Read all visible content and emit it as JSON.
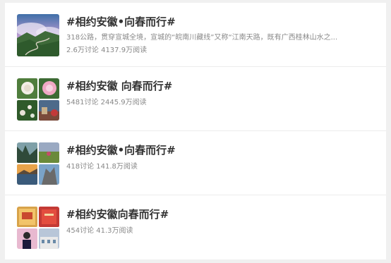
{
  "topics": [
    {
      "title": "#相约安徽•向春而行#",
      "desc": "318公路，贯穿宣城全境，宣城的“皖南川藏线”又称“江南天路，既有广西桂林山水之...",
      "stats": "2.6万讨论 4137.9万阅读",
      "thumb_type": "single",
      "thumb_name": "mountain-road-photo"
    },
    {
      "title": "#相约安徽 向春而行#",
      "stats": "5481讨论 2445.9万阅读",
      "thumb_type": "grid",
      "thumb_names": [
        "rose-photo",
        "peony-photo",
        "flower-field-photo",
        "street-photo"
      ]
    },
    {
      "title": "#相约安徽•向春而行#",
      "stats": "418讨论 141.8万阅读",
      "thumb_type": "grid",
      "thumb_names": [
        "valley-photo",
        "meadow-photo",
        "sunset-lake-photo",
        "rock-peak-photo"
      ]
    },
    {
      "title": "#相约安徽向春而行#",
      "stats": "454讨论 41.3万阅读",
      "thumb_type": "grid",
      "thumb_names": [
        "poster-photo",
        "book-photo",
        "person-photo",
        "building-photo"
      ]
    }
  ],
  "colors": {
    "title": "#333333",
    "meta": "#888888",
    "background": "#f0f0f0",
    "panel": "#ffffff"
  }
}
